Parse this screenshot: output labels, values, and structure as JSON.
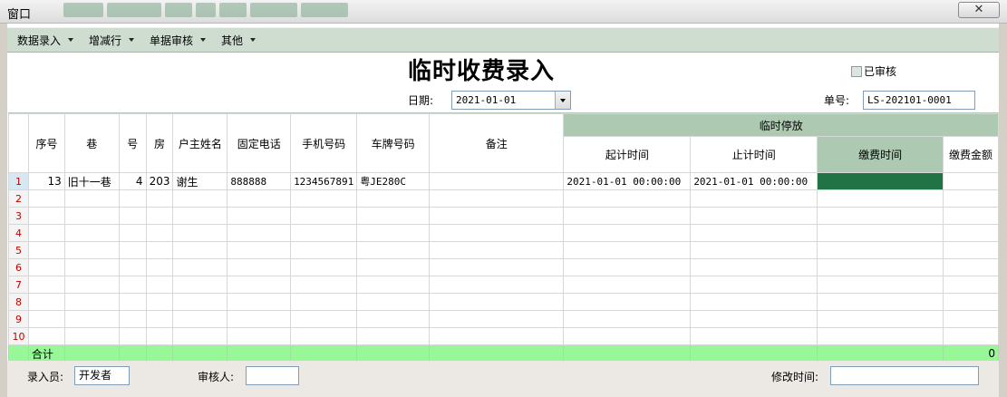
{
  "window": {
    "title": "窗口",
    "close_glyph": "✕"
  },
  "menu": [
    {
      "label": "数据录入"
    },
    {
      "label": "增减行"
    },
    {
      "label": "单据审核"
    },
    {
      "label": "其他"
    }
  ],
  "header": {
    "title": "临时收费录入",
    "audited_label": "已审核",
    "audited": false,
    "date_label": "日期:",
    "date_value": "2021-01-01",
    "no_label": "单号:",
    "no_value": "LS-202101-0001"
  },
  "grid": {
    "group_header": "临时停放",
    "columns": [
      "序号",
      "巷",
      "号",
      "房",
      "户主姓名",
      "固定电话",
      "手机号码",
      "车牌号码",
      "备注",
      "起计时间",
      "止计时间",
      "缴费时间",
      "缴费金额"
    ],
    "row_numbers": [
      "1",
      "2",
      "3",
      "4",
      "5",
      "6",
      "7",
      "8",
      "9",
      "10"
    ],
    "rows": [
      {
        "seq": "13",
        "lane": "旧十一巷",
        "num": "4",
        "room": "203",
        "owner": "谢生",
        "phone": "888888",
        "mobile": "1234567891",
        "plate": "粤JE280C",
        "remark": "",
        "start": "2021-01-01 00:00:00",
        "end": "2021-01-01 00:00:00",
        "paytime": "",
        "amount": ""
      }
    ],
    "total_label": "合计",
    "total_amount": "0",
    "colors": {
      "group_header": "#adc9b2",
      "selected_cell": "#217346",
      "total_row": "#98f898",
      "row_number": "#c00000"
    }
  },
  "footer": {
    "entry_label": "录入员:",
    "entry_value": "开发者",
    "reviewer_label": "审核人:",
    "reviewer_value": "",
    "modified_label": "修改时间:",
    "modified_value": ""
  }
}
